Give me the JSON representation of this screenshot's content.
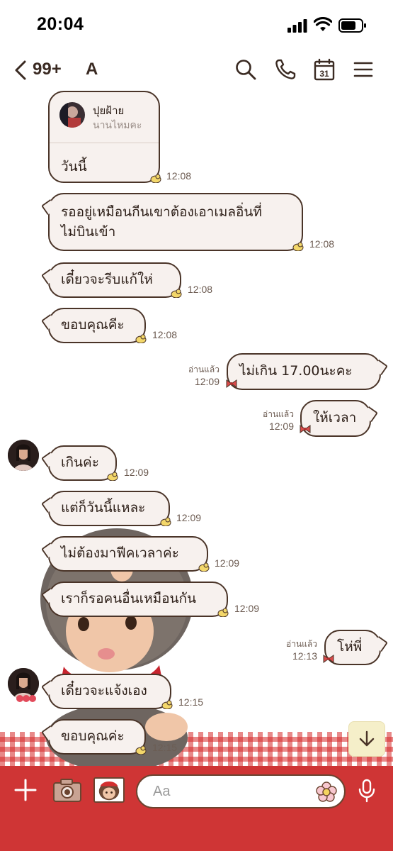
{
  "status_bar": {
    "time": "20:04"
  },
  "header": {
    "unread_count": "99+",
    "chat_name": "A",
    "calendar_day": "31"
  },
  "reply_message": {
    "quoted_name": "ปุยฝ้าย",
    "quoted_text": "นานไหมคะ",
    "text": "วันนี้",
    "time": "12:08"
  },
  "messages": [
    {
      "side": "left",
      "text": "รออยู่เหมือนกีนเขาต้องเอาเมลอิ่นที่ไม่บินเข้า",
      "line1": "รออยู่เหมือนกีนเขาต้องเอาเมลอิ่นที่",
      "line2": "ไม่บินเข้า",
      "time": "12:08"
    },
    {
      "side": "left",
      "text": "เดี๋ยวจะรีบแก้ให่",
      "time": "12:08"
    },
    {
      "side": "left",
      "text": "ขอบคุณคีะ",
      "time": "12:08"
    },
    {
      "side": "right",
      "text": "ไม่เกิน 17.00นะคะ",
      "read": "อ่านแล้ว",
      "time": "12:09"
    },
    {
      "side": "right",
      "text": "ให้เวลา",
      "read": "อ่านแล้ว",
      "time": "12:09"
    },
    {
      "side": "left",
      "text": "เกินค่ะ",
      "time": "12:09"
    },
    {
      "side": "left",
      "text": "แต่ก็วันนี้แหละ",
      "time": "12:09"
    },
    {
      "side": "left",
      "text": "ไม่ต้องมาฟีคเวลาค่ะ",
      "time": "12:09"
    },
    {
      "side": "left",
      "text": "เราก็รอคนอื่นเหมือนกัน",
      "time": "12:09"
    },
    {
      "side": "right",
      "text": "โห่พี่",
      "read": "อ่านแล้ว",
      "time": "12:13"
    },
    {
      "side": "left",
      "text": "เดี๋ยวจะแจ้งเอง",
      "time": "12:15"
    },
    {
      "side": "left",
      "text": "ขอบคุณค่ะ",
      "time": "12:15"
    }
  ],
  "composer": {
    "placeholder": "Aa"
  },
  "icons": {
    "back": "chevron-left-icon",
    "search": "search-icon",
    "call": "phone-icon",
    "calendar": "calendar-icon",
    "menu": "menu-icon",
    "add": "plus-icon",
    "camera": "camera-icon",
    "sticker": "sticker-icon",
    "emoji": "flower-emoji-icon",
    "mic": "microphone-icon",
    "scroll": "arrow-down-icon"
  },
  "colors": {
    "bubble_bg": "#f7f1ee",
    "bubble_border": "#4a3428",
    "bottom_bar": "#cf3535",
    "checker": "#d62828"
  }
}
